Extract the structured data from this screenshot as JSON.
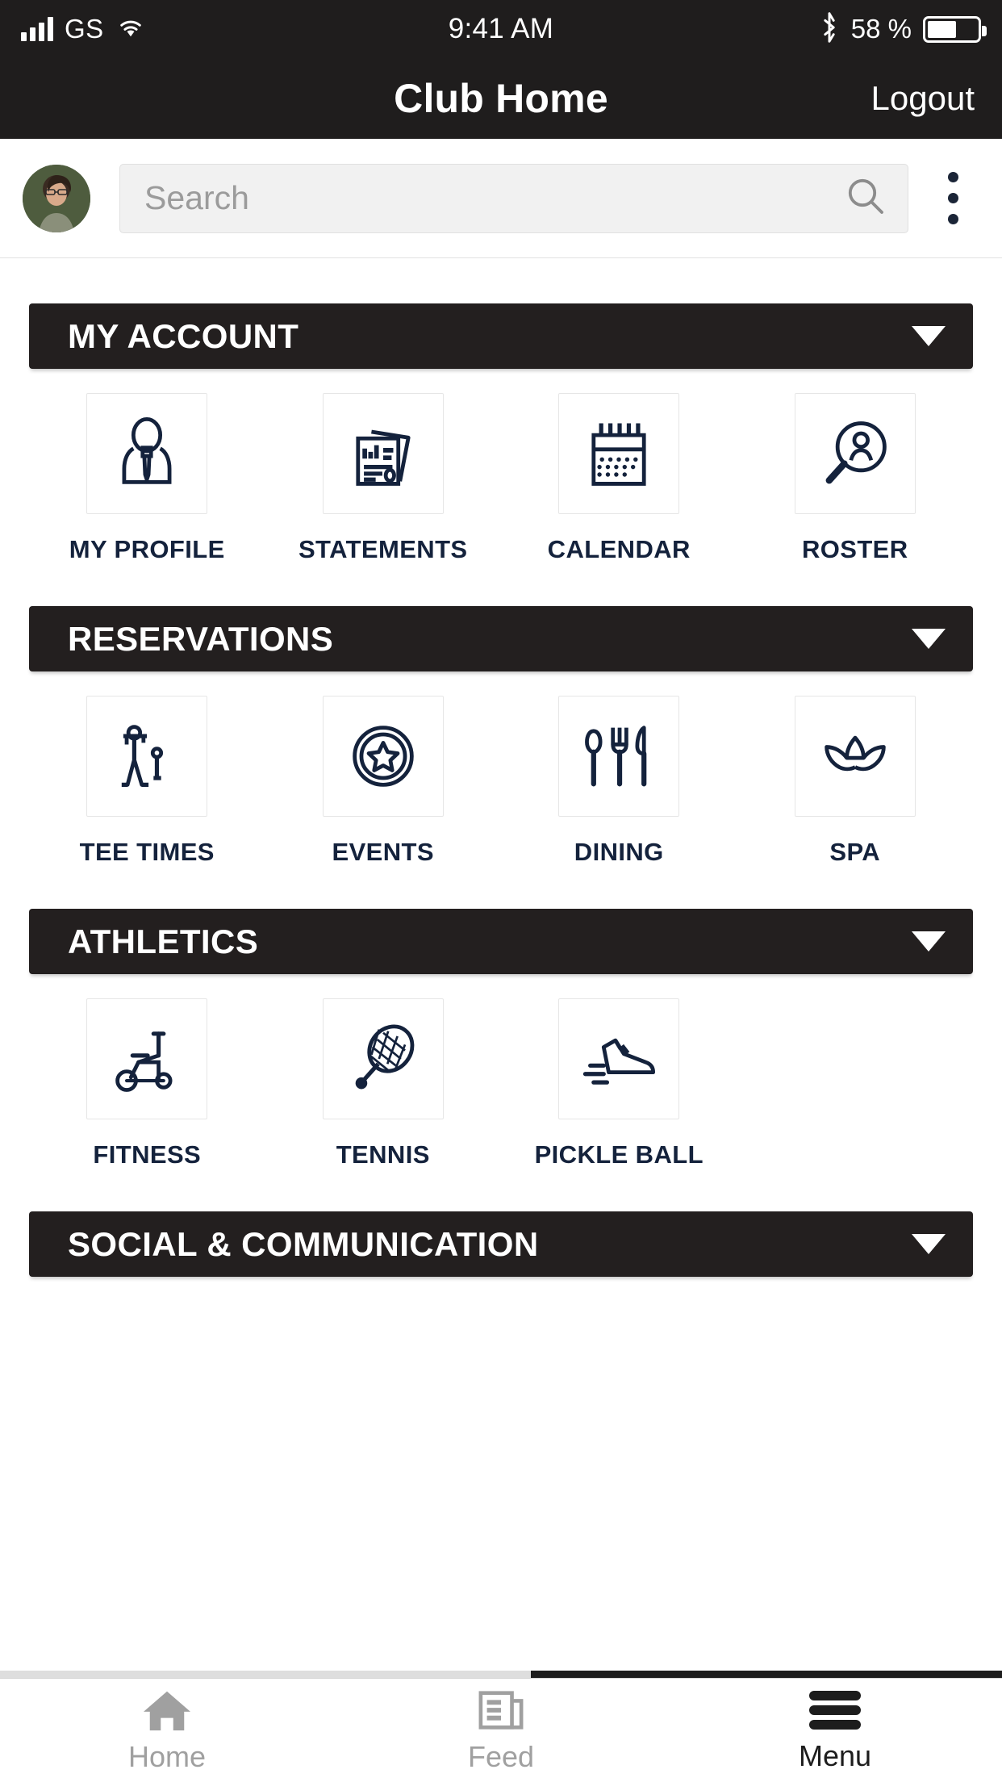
{
  "status_bar": {
    "carrier": "GS",
    "time": "9:41 AM",
    "battery_percent": "58 %",
    "signal_icon": "cellular-signal-icon",
    "wifi_icon": "wifi-icon",
    "bluetooth_icon": "bluetooth-icon",
    "battery_icon": "battery-icon"
  },
  "navbar": {
    "title": "Club Home",
    "logout_label": "Logout"
  },
  "search": {
    "placeholder": "Search",
    "value": "",
    "search_icon": "search-icon",
    "avatar_icon": "user-avatar",
    "overflow_icon": "kebab-menu-icon"
  },
  "colors": {
    "header_bar": "#231f1f",
    "navbar": "#1f1d1d",
    "icon": "#14223c",
    "label": "#14223c",
    "search_bg": "#f1f1f1",
    "tab_inactive": "#a0a0a0",
    "tab_active": "#1d1d1d"
  },
  "sections": [
    {
      "title": "MY ACCOUNT",
      "chevron_icon": "chevron-down-icon",
      "expanded": true,
      "tiles": [
        {
          "label": "MY PROFILE",
          "icon": "person-tie-icon"
        },
        {
          "label": "STATEMENTS",
          "icon": "documents-chart-icon"
        },
        {
          "label": "CALENDAR",
          "icon": "calendar-icon"
        },
        {
          "label": "ROSTER",
          "icon": "magnifier-person-icon"
        }
      ]
    },
    {
      "title": "RESERVATIONS",
      "chevron_icon": "chevron-down-icon",
      "expanded": true,
      "tiles": [
        {
          "label": "TEE TIMES",
          "icon": "golfer-icon"
        },
        {
          "label": "EVENTS",
          "icon": "star-badge-icon"
        },
        {
          "label": "DINING",
          "icon": "cutlery-icon"
        },
        {
          "label": "SPA",
          "icon": "lotus-icon"
        }
      ]
    },
    {
      "title": "ATHLETICS",
      "chevron_icon": "chevron-down-icon",
      "expanded": true,
      "tiles": [
        {
          "label": "FITNESS",
          "icon": "exercise-bike-icon"
        },
        {
          "label": "TENNIS",
          "icon": "tennis-racket-icon"
        },
        {
          "label": "PICKLE BALL",
          "icon": "sneaker-icon"
        }
      ]
    },
    {
      "title": "SOCIAL & COMMUNICATION",
      "chevron_icon": "chevron-down-icon",
      "expanded": false,
      "tiles": []
    }
  ],
  "tabbar": {
    "items": [
      {
        "label": "Home",
        "icon": "home-icon",
        "active": false
      },
      {
        "label": "Feed",
        "icon": "feed-icon",
        "active": false
      },
      {
        "label": "Menu",
        "icon": "hamburger-icon",
        "active": true
      }
    ]
  }
}
